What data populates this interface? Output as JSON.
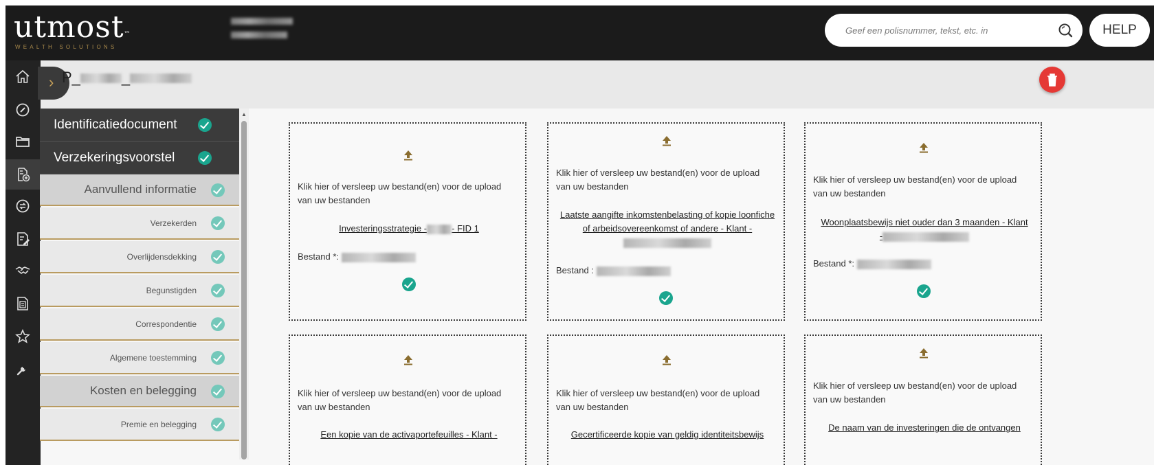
{
  "header": {
    "logo_text": "utmost",
    "logo_tm": "™",
    "logo_sub": "WEALTH SOLUTIONS",
    "search_placeholder": "Geef een polisnummer, tekst, etc. in",
    "help_label": "HELP"
  },
  "rail": {
    "icons": [
      "home-icon",
      "dashboard-icon",
      "folder-icon",
      "new-policy-icon",
      "globe-transfer-icon",
      "edit-document-icon",
      "handshake-icon",
      "calculator-document-icon",
      "star-icon",
      "wrench-icon"
    ],
    "active_index": 3
  },
  "page": {
    "title": "P_",
    "title_mid": "_"
  },
  "steps": [
    {
      "label": "Identificatiedocument",
      "type": "dark",
      "done": true
    },
    {
      "label": "Verzekeringsvoorstel",
      "type": "dark",
      "done": true
    },
    {
      "label": "Aanvullend informatie",
      "type": "section",
      "done": true
    },
    {
      "label": "Verzekerden",
      "type": "sub",
      "done": true
    },
    {
      "label": "Overlijdensdekking",
      "type": "sub",
      "done": true
    },
    {
      "label": "Begunstigden",
      "type": "sub",
      "done": true
    },
    {
      "label": "Correspondentie",
      "type": "sub",
      "done": true
    },
    {
      "label": "Algemene toestemming",
      "type": "sub",
      "done": true
    },
    {
      "label": "Kosten en belegging",
      "type": "section",
      "done": true
    },
    {
      "label": "Premie en belegging",
      "type": "sub",
      "done": true
    }
  ],
  "cards": {
    "instruction": "Klik hier of versleep uw bestand(en) voor de upload van uw bestanden",
    "items": [
      {
        "doc_a": "Investeringsstrategie -",
        "doc_b": "- FID 1",
        "bestand_label": "Bestand *:",
        "uploaded": true
      },
      {
        "doc_a": "Laatste aangifte inkomstenbelasting of kopie loonfiche of arbeidsovereenkomst of andere - Klant -",
        "doc_b": "",
        "bestand_label": "Bestand :",
        "uploaded": true
      },
      {
        "doc_a": "Woonplaatsbewijs niet ouder dan 3 maanden - Klant",
        "doc_b": "-",
        "bestand_label": "Bestand *:",
        "uploaded": true
      },
      {
        "doc_a": "Een kopie van de activaportefeuilles - Klant -",
        "doc_b": "",
        "bestand_label": "",
        "uploaded": false
      },
      {
        "doc_a": "Gecertificeerde kopie van geldig identiteitsbewijs",
        "doc_b": "",
        "bestand_label": "",
        "uploaded": false
      },
      {
        "doc_a": "De naam van de investeringen die de ontvangen",
        "doc_b": "",
        "bestand_label": "",
        "uploaded": false
      }
    ]
  },
  "colors": {
    "topbar": "#1b1b1b",
    "gold": "#b99b60",
    "check": "#1aa58e",
    "delete": "#e53935"
  }
}
